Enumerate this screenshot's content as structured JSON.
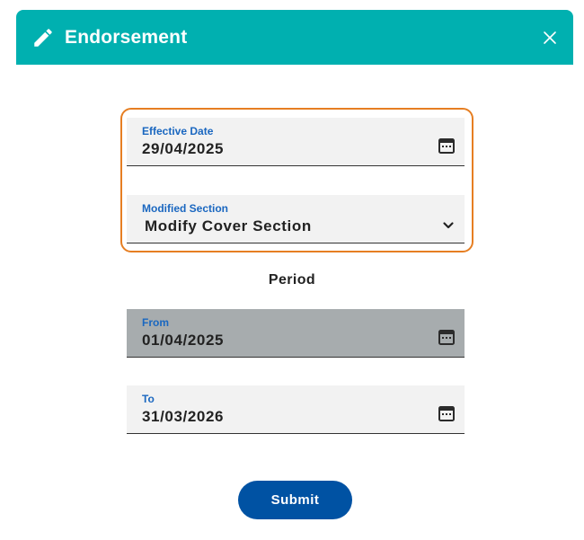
{
  "header": {
    "title": "Endorsement",
    "icon": "pencil-icon",
    "close_icon": "close-icon",
    "background_color": "#00b0b0"
  },
  "form": {
    "effective_date": {
      "label": "Effective Date",
      "value": "29/04/2025",
      "icon": "calendar-icon"
    },
    "modified_section": {
      "label": "Modified Section",
      "value": "Modify Cover Section",
      "icon": "chevron-down-icon"
    },
    "period_heading": "Period",
    "from": {
      "label": "From",
      "value": "01/04/2025",
      "icon": "calendar-icon",
      "disabled": true
    },
    "to": {
      "label": "To",
      "value": "31/03/2026",
      "icon": "calendar-icon"
    },
    "highlight_color": "#e67e22"
  },
  "actions": {
    "submit_label": "Submit",
    "submit_color": "#0052a3"
  }
}
